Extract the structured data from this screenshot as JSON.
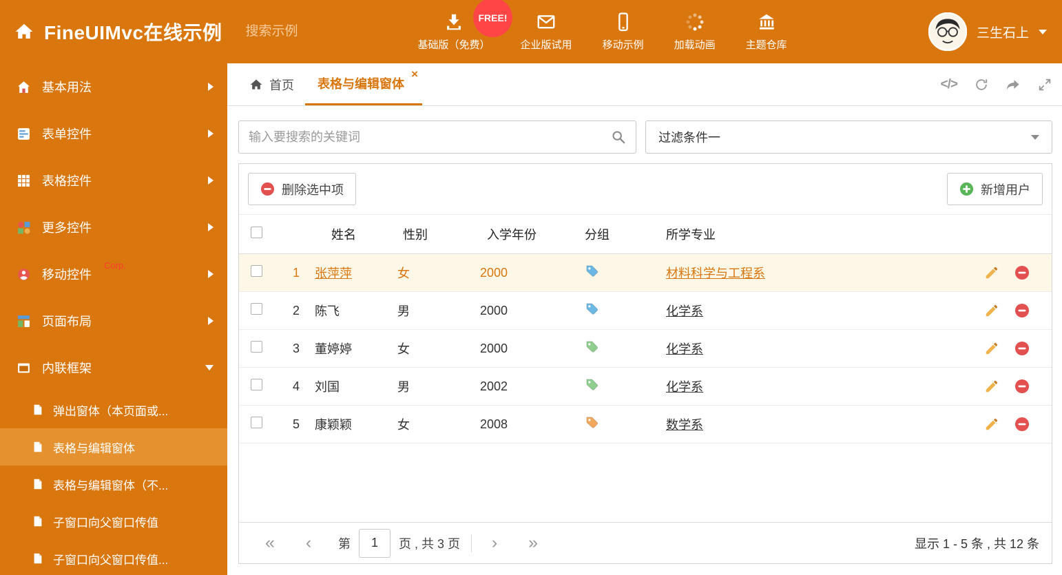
{
  "colors": {
    "accent": "#D9770E",
    "selected_row_bg": "#FCF7E6",
    "tag_blue": "#6CB8E4",
    "tag_green": "#8FCE8F",
    "tag_orange": "#F2A85C"
  },
  "header": {
    "title": "FineUIMvc在线示例",
    "search_placeholder": "搜索示例",
    "free_badge": "FREE!",
    "nav": [
      {
        "label": "基础版（免费）",
        "icon": "download-icon"
      },
      {
        "label": "企业版试用",
        "icon": "envelope-icon"
      },
      {
        "label": "移动示例",
        "icon": "mobile-icon"
      },
      {
        "label": "加载动画",
        "icon": "spinner-icon"
      },
      {
        "label": "主题仓库",
        "icon": "bank-icon"
      }
    ],
    "user_name": "三生石上"
  },
  "sidebar": {
    "items": [
      {
        "label": "基本用法"
      },
      {
        "label": "表单控件"
      },
      {
        "label": "表格控件"
      },
      {
        "label": "更多控件"
      },
      {
        "label": "移动控件",
        "badge": "Corp."
      },
      {
        "label": "页面布局"
      },
      {
        "label": "内联框架"
      }
    ],
    "subitems": [
      {
        "label": "弹出窗体（本页面或..."
      },
      {
        "label": "表格与编辑窗体"
      },
      {
        "label": "表格与编辑窗体（不..."
      },
      {
        "label": "子窗口向父窗口传值"
      },
      {
        "label": "子窗口向父窗口传值..."
      }
    ]
  },
  "tabs": {
    "home": "首页",
    "active": "表格与编辑窗体",
    "close_icon": "×",
    "code_icon": "</>"
  },
  "filters": {
    "search_placeholder": "输入要搜索的关键词",
    "filter_value": "过滤条件一"
  },
  "toolbar": {
    "delete_label": "删除选中项",
    "add_label": "新增用户"
  },
  "table": {
    "columns": {
      "name": "姓名",
      "gender": "性别",
      "year": "入学年份",
      "group": "分组",
      "major": "所学专业"
    },
    "rows": [
      {
        "num": "1",
        "name": "张萍萍",
        "gender": "女",
        "year": "2000",
        "major": "材料科学与工程系",
        "tag": "#6CB8E4",
        "selected": true
      },
      {
        "num": "2",
        "name": "陈飞",
        "gender": "男",
        "year": "2000",
        "major": "化学系",
        "tag": "#6CB8E4",
        "selected": false
      },
      {
        "num": "3",
        "name": "董婷婷",
        "gender": "女",
        "year": "2000",
        "major": "化学系",
        "tag": "#8FCE8F",
        "selected": false
      },
      {
        "num": "4",
        "name": "刘国",
        "gender": "男",
        "year": "2002",
        "major": "化学系",
        "tag": "#8FCE8F",
        "selected": false
      },
      {
        "num": "5",
        "name": "康颖颖",
        "gender": "女",
        "year": "2008",
        "major": "数学系",
        "tag": "#F2A85C",
        "selected": false
      }
    ]
  },
  "pagination": {
    "first_icon": "«",
    "prev_icon": "‹",
    "next_icon": "›",
    "last_icon": "»",
    "page_label_before": "第",
    "page_value": "1",
    "page_label_after": "页 , 共 3 页",
    "summary": "显示 1 - 5 条 , 共 12 条"
  }
}
